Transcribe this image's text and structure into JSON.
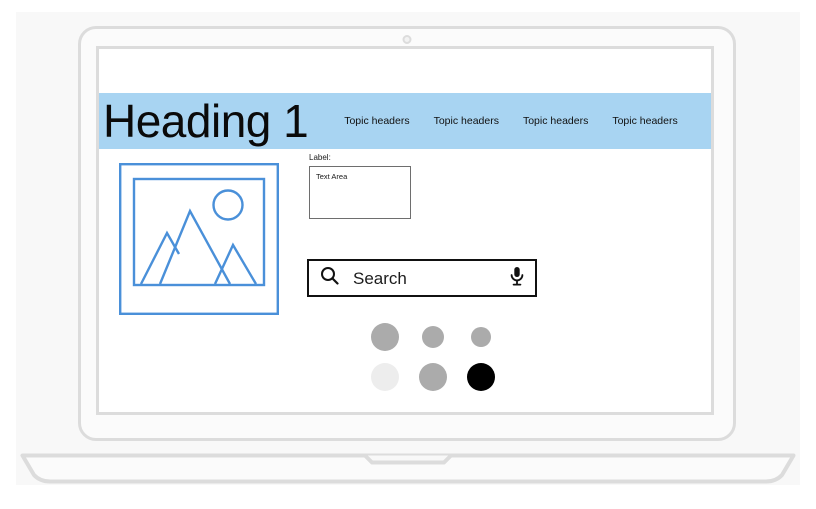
{
  "device": {
    "type": "laptop-mockup",
    "frame_color": "#dcdcdc",
    "backdrop_color": "#f8f8f8",
    "camera": "camera-dot"
  },
  "header": {
    "band_color": "#a8d4f2",
    "title": "Heading 1",
    "nav_items": [
      {
        "label": "Topic headers"
      },
      {
        "label": "Topic headers"
      },
      {
        "label": "Topic headers"
      },
      {
        "label": "Topic headers"
      }
    ]
  },
  "main": {
    "image_placeholder": {
      "name": "image-placeholder-icon",
      "stroke_color": "#4a90d9"
    },
    "field": {
      "label": "Label:",
      "textarea_value": "Text Area",
      "textarea_placeholder": "Text Area",
      "border_color": "#6e6e6e"
    },
    "search": {
      "value": "Search",
      "placeholder": "Search",
      "search_icon": "magnifier-icon",
      "mic_icon": "microphone-icon",
      "border_color": "#111111"
    },
    "swatches": {
      "rows": [
        [
          {
            "color": "#ababab",
            "size": 28
          },
          {
            "color": "#ababab",
            "size": 22
          },
          {
            "color": "#ababab",
            "size": 20
          }
        ],
        [
          {
            "color": "#ededed",
            "size": 28
          },
          {
            "color": "#ababab",
            "size": 28
          },
          {
            "color": "#000000",
            "size": 28
          }
        ]
      ]
    }
  }
}
